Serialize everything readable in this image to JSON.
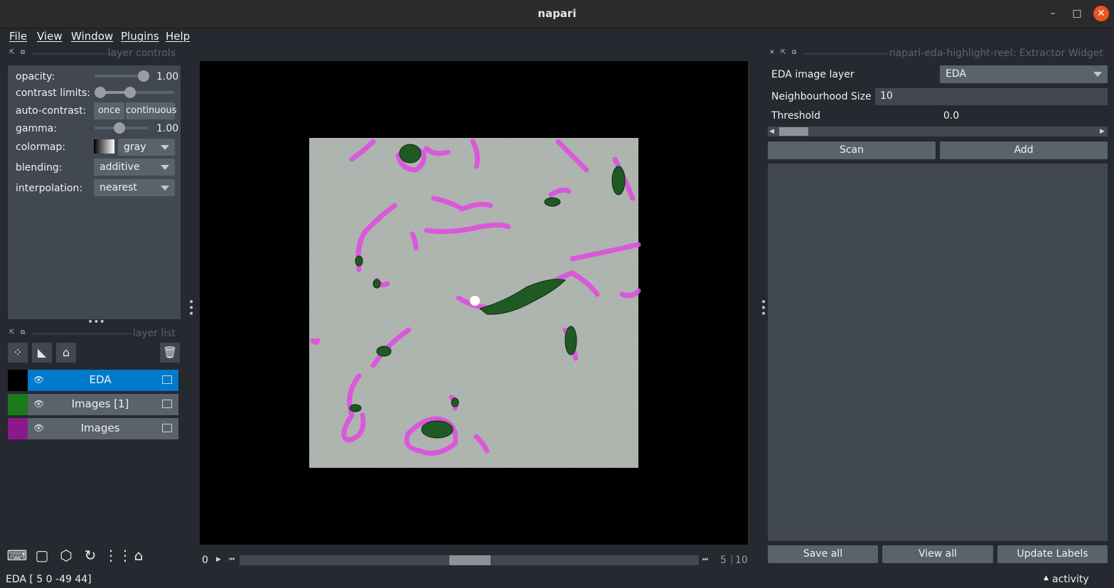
{
  "window": {
    "title": "napari",
    "minimize": "–",
    "maximize": "□",
    "close": "✕"
  },
  "menu": [
    "File",
    "View",
    "Window",
    "Plugins",
    "Help"
  ],
  "layer_controls": {
    "header": "layer controls",
    "opacity_label": "opacity:",
    "opacity_value": "1.00",
    "contrast_label": "contrast limits:",
    "autocontrast_label": "auto-contrast:",
    "once": "once",
    "continuous": "continuous",
    "gamma_label": "gamma:",
    "gamma_value": "1.00",
    "colormap_label": "colormap:",
    "colormap_value": "gray",
    "blending_label": "blending:",
    "blending_value": "additive",
    "interpolation_label": "interpolation:",
    "interpolation_value": "nearest"
  },
  "layer_list": {
    "header": "layer list",
    "layers": [
      {
        "name": "EDA",
        "selected": true,
        "thumb_color": "#000000"
      },
      {
        "name": "Images [1]",
        "selected": false,
        "thumb_color": "#1a7a1a"
      },
      {
        "name": "Images",
        "selected": false,
        "thumb_color": "#8a1a8a"
      }
    ]
  },
  "dims": {
    "current": "0",
    "slider_value": "5",
    "slider_max": "10"
  },
  "status": {
    "text": "EDA [  5   0 -49  44]",
    "activity": "activity"
  },
  "plugin": {
    "header": "napari-eda-highlight-reel: Extractor Widget",
    "eda_layer_label": "EDA image layer",
    "eda_layer_value": "EDA",
    "neighbourhood_label": "Neighbourhood Size",
    "neighbourhood_value": "10",
    "threshold_label": "Threshold",
    "threshold_value": "0.0",
    "scan": "Scan",
    "add": "Add",
    "save_all": "Save all",
    "view_all": "View all",
    "update_labels": "Update Labels"
  },
  "colors": {
    "accent": "#007acc",
    "background": "#262930",
    "panel": "#414851",
    "control": "#5a626c"
  }
}
